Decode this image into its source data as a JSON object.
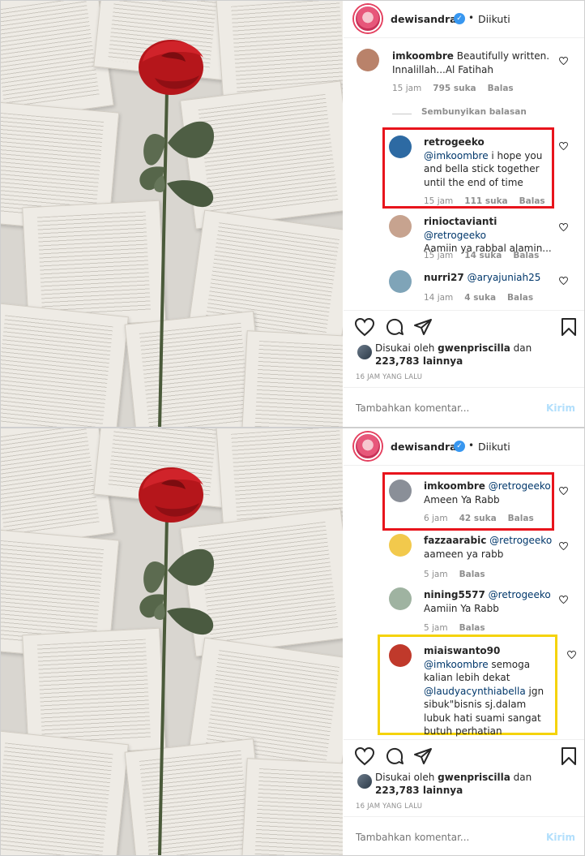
{
  "panels": [
    {
      "header": {
        "username": "dewisandra",
        "verified_mark": "✓",
        "dot": "•",
        "follow_label": "Diikuti"
      },
      "hide_replies_label": "Sembunyikan balasan",
      "comments": [
        {
          "username": "imkoombre",
          "mention": "",
          "text": "Beautifully written. Innalillah...Al Fatihah",
          "time": "15 jam",
          "likes": "795 suka",
          "reply": "Balas",
          "avatar_color": "#b9826a"
        },
        {
          "username": "retrogeeko",
          "mention": "@imkoombre",
          "text": " i hope you and bella stick together until the end of time",
          "time": "15 jam",
          "likes": "111 suka",
          "reply": "Balas",
          "avatar_color": "#2d6aa3"
        },
        {
          "username": "rinioctavianti",
          "mention": "@retrogeeko",
          "text": "Aamiin ya rabbal alamin...",
          "time": "15 jam",
          "likes": "14 suka",
          "reply": "Balas",
          "avatar_color": "#c7a38f"
        },
        {
          "username": "nurri27",
          "mention": "@aryajuniah25",
          "text": "",
          "time": "14 jam",
          "likes": "4 suka",
          "reply": "Balas",
          "avatar_color": "#7fa4b8"
        }
      ],
      "liked_by": {
        "prefix": "Disukai oleh ",
        "user": "gwenpriscilla",
        "suffix": " dan",
        "count": "223,783 lainnya"
      },
      "timestamp": "16 JAM YANG LALU",
      "comment_placeholder": "Tambahkan komentar...",
      "post_label": "Kirim"
    },
    {
      "header": {
        "username": "dewisandra",
        "verified_mark": "✓",
        "dot": "•",
        "follow_label": "Diikuti"
      },
      "comments": [
        {
          "username": "imkoombre",
          "mention": "@retrogeeko",
          "text": "Ameen Ya Rabb",
          "time": "6 jam",
          "likes": "42 suka",
          "reply": "Balas",
          "avatar_color": "#8a8f98"
        },
        {
          "username": "fazzaarabic",
          "mention": "@retrogeeko",
          "text": "aameen ya rabb",
          "time": "5 jam",
          "likes": "",
          "reply": "Balas",
          "avatar_color": "#f2c94c"
        },
        {
          "username": "nining5577",
          "mention": "@retrogeeko",
          "text": "Aamiin Ya Rabb",
          "time": "5 jam",
          "likes": "",
          "reply": "Balas",
          "avatar_color": "#9fb3a1"
        },
        {
          "username": "miaiswanto90",
          "mention": "@imkoombre",
          "mention2": "@laudyacynthiabella",
          "text": " semoga kalian lebih dekat",
          "text2": " jgn sibuk\"bisnis sj.dalam lubuk hati suami sangat butuh perhatian",
          "avatar_color": "#c0392b"
        }
      ],
      "liked_by": {
        "prefix": "Disukai oleh ",
        "user": "gwenpriscilla",
        "suffix": " dan",
        "count": "223,783 lainnya"
      },
      "timestamp": "16 JAM YANG LALU",
      "comment_placeholder": "Tambahkan komentar...",
      "post_label": "Kirim"
    }
  ],
  "colors": {
    "highlight_red": "#e8141c",
    "highlight_yellow": "#f5d30a",
    "mention": "#00376b",
    "verified": "#3897f0"
  },
  "icons": [
    "heart-icon",
    "comment-icon",
    "share-icon",
    "bookmark-icon",
    "small-heart-icon",
    "verified-badge-icon"
  ]
}
